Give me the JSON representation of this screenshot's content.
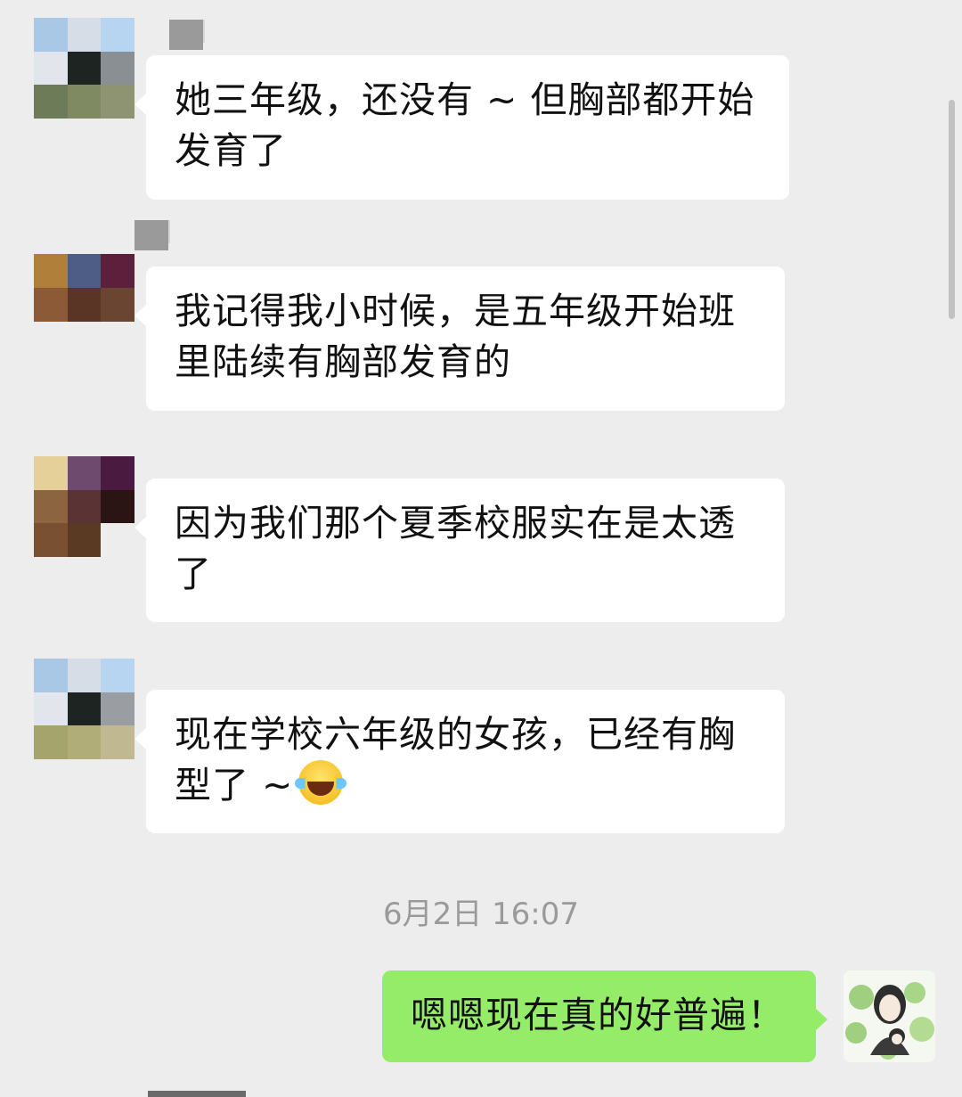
{
  "messages": [
    {
      "sender": "other",
      "text": "她三年级，还没有 ~ 但胸部都开始发育了"
    },
    {
      "sender": "other",
      "text": "我记得我小时候，是五年级开始班里陆续有胸部发育的"
    },
    {
      "sender": "other",
      "text": "因为我们那个夏季校服实在是太透了"
    },
    {
      "sender": "other",
      "text": "现在学校六年级的女孩，已经有胸型了 ~",
      "emoji": "tears-of-joy-emoji"
    },
    {
      "sender": "me",
      "text": "嗯嗯现在真的好普遍！"
    }
  ],
  "timestamp": "6月2日 16:07",
  "colors": {
    "background": "#ededed",
    "incoming_bubble": "#ffffff",
    "outgoing_bubble": "#95ec69",
    "timestamp_text": "#9a9a9a"
  }
}
